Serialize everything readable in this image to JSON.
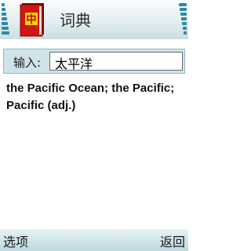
{
  "app": {
    "title": "词典",
    "icon": "dictionary-book-icon"
  },
  "colors": {
    "accent": "#2b8ba1",
    "book_red": "#d11414",
    "book_gold": "#ffd200"
  },
  "search": {
    "label": "输入:",
    "value": "太平洋"
  },
  "result": {
    "lines": [
      "the Pacific Ocean; the Pacific;",
      "Pacific (adj.)"
    ]
  },
  "softkeys": {
    "left": "选项",
    "right": "返回"
  }
}
